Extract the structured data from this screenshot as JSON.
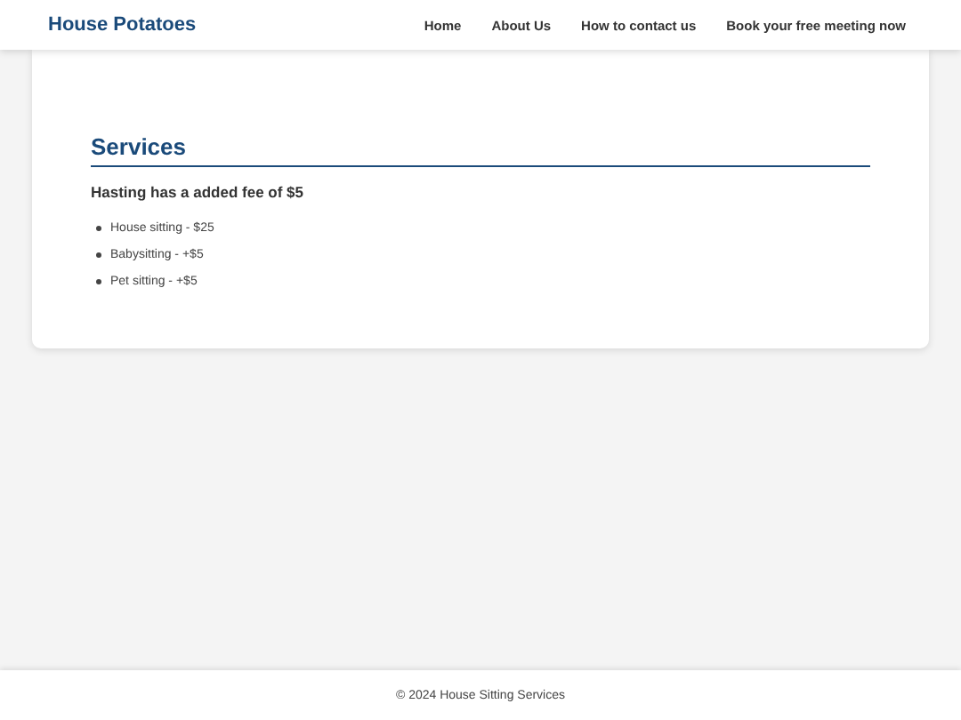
{
  "header": {
    "logo": "House Potatoes",
    "nav": [
      {
        "label": "Home"
      },
      {
        "label": "About Us"
      },
      {
        "label": "How to contact us"
      },
      {
        "label": "Book your free meeting now"
      }
    ]
  },
  "section": {
    "title": "Services",
    "note": "Hasting has a added fee of $5",
    "items": [
      "House sitting - $25",
      "Babysitting - +$5",
      "Pet sitting - +$5"
    ]
  },
  "footer": {
    "text": "© 2024 House Sitting Services"
  }
}
